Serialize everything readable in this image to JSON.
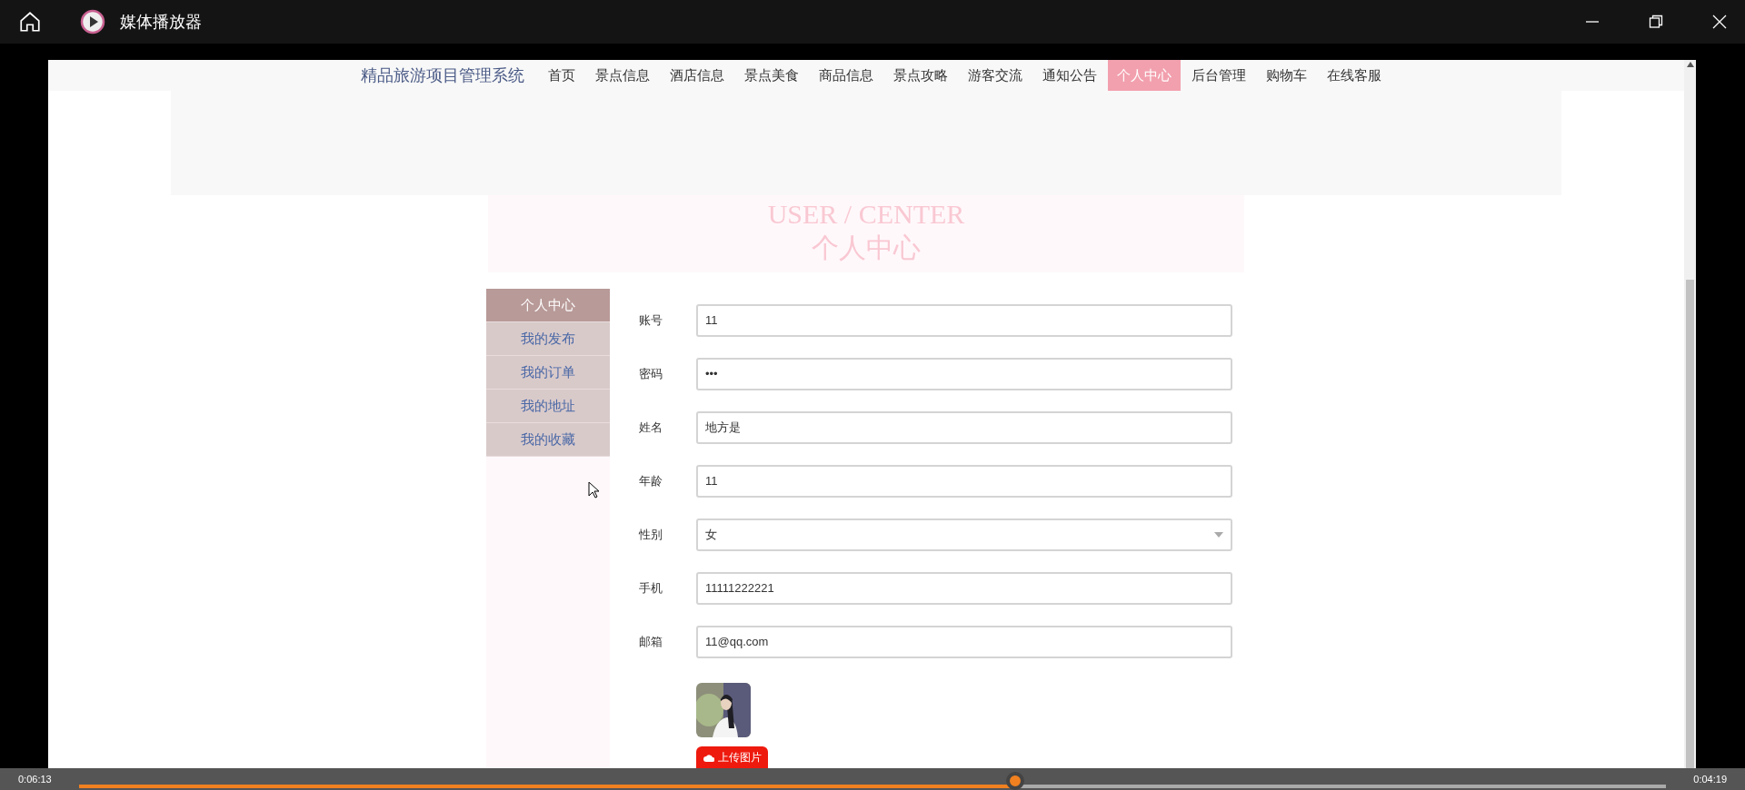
{
  "window": {
    "title": "媒体播放器"
  },
  "nav": {
    "brand": "精品旅游项目管理系统",
    "items": [
      {
        "label": "首页",
        "selected": false
      },
      {
        "label": "景点信息",
        "selected": false
      },
      {
        "label": "酒店信息",
        "selected": false
      },
      {
        "label": "景点美食",
        "selected": false
      },
      {
        "label": "商品信息",
        "selected": false
      },
      {
        "label": "景点攻略",
        "selected": false
      },
      {
        "label": "游客交流",
        "selected": false
      },
      {
        "label": "通知公告",
        "selected": false
      },
      {
        "label": "个人中心",
        "selected": true
      },
      {
        "label": "后台管理",
        "selected": false
      },
      {
        "label": "购物车",
        "selected": false
      },
      {
        "label": "在线客服",
        "selected": false
      }
    ]
  },
  "header": {
    "title_en": "USER / CENTER",
    "title": "个人中心"
  },
  "sidebar": {
    "items": [
      {
        "label": "个人中心",
        "selected": true
      },
      {
        "label": "我的发布",
        "selected": false
      },
      {
        "label": "我的订单",
        "selected": false
      },
      {
        "label": "我的地址",
        "selected": false
      },
      {
        "label": "我的收藏",
        "selected": false
      }
    ]
  },
  "form": {
    "fields": [
      {
        "label": "账号",
        "kind": "text",
        "value": "11"
      },
      {
        "label": "密码",
        "kind": "text",
        "value": "•••"
      },
      {
        "label": "姓名",
        "kind": "text",
        "value": "地方是"
      },
      {
        "label": "年龄",
        "kind": "text",
        "value": "11"
      },
      {
        "label": "性别",
        "kind": "select",
        "value": "女"
      },
      {
        "label": "手机",
        "kind": "text",
        "value": "11111222221"
      },
      {
        "label": "邮箱",
        "kind": "text",
        "value": "11@qq.com"
      }
    ],
    "upload_button": "上传图片"
  },
  "player": {
    "elapsed": "0:06:13",
    "remaining": "0:04:19",
    "progress": {
      "level": 0.59
    }
  }
}
